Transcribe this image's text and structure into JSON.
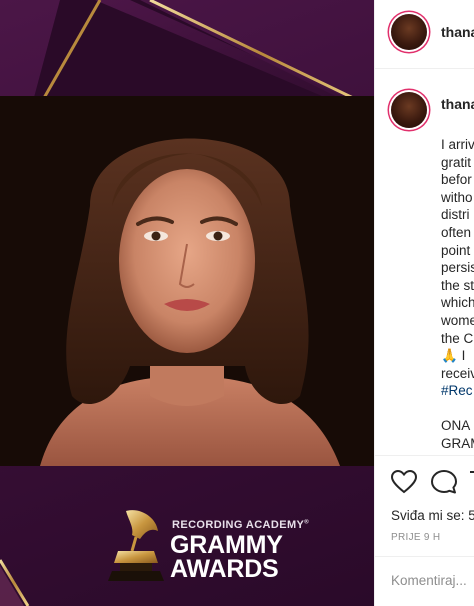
{
  "post": {
    "logo": {
      "organization": "RECORDING ACADEMY",
      "trademark": "®",
      "line1": "GRAMMY",
      "line2": "AWARDS"
    }
  },
  "header": {
    "username": "thana"
  },
  "caption": {
    "username": "thana",
    "lines": [
      "I arriv",
      "gratit",
      "befor",
      "witho",
      "distri",
      "often",
      "point",
      "persis",
      "the st",
      "which",
      "wome",
      "the C"
    ],
    "emoji_line_text": "I",
    "line_after_emoji": "receiv",
    "hashtag": "#Rec",
    "line_after_break_1": "ONA",
    "line_after_break_2": "GRAM"
  },
  "actions": {
    "likes_text": "Sviđa mi se: 5",
    "time_text": "PRIJE 9 H",
    "comment_placeholder": "Komentiraj..."
  },
  "colors": {
    "background_purple": "#3a0f38",
    "frame_gold": "#c9a25a",
    "link_blue": "#00376b",
    "story_ring": "#e1306c"
  },
  "icons": [
    "heart-icon",
    "comment-icon",
    "share-icon",
    "gramophone-icon"
  ]
}
